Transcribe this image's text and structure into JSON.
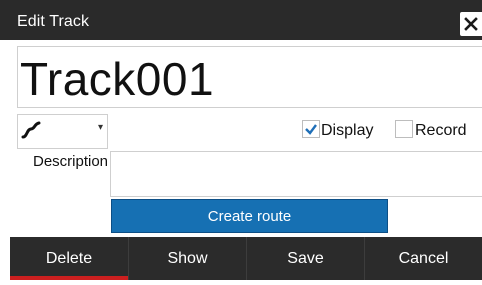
{
  "dialog": {
    "title": "Edit Track",
    "close_icon": "close-icon"
  },
  "name_field": {
    "value": "Track001"
  },
  "style_select": {
    "icon": "track-line-icon",
    "dropdown_icon": "chevron-down-icon"
  },
  "options": {
    "display_label": "Display",
    "display_checked": true,
    "record_label": "Record",
    "record_checked": false
  },
  "description": {
    "label": "Description",
    "value": ""
  },
  "create_route_label": "Create route",
  "bottom_bar": {
    "delete_label": "Delete",
    "show_label": "Show",
    "save_label": "Save",
    "cancel_label": "Cancel",
    "active": "Delete"
  },
  "colors": {
    "titlebar": "#2a2a2a",
    "accent_blue": "#1670b3",
    "active_underline": "#cc1f1f",
    "check_blue": "#1f6fb8"
  }
}
